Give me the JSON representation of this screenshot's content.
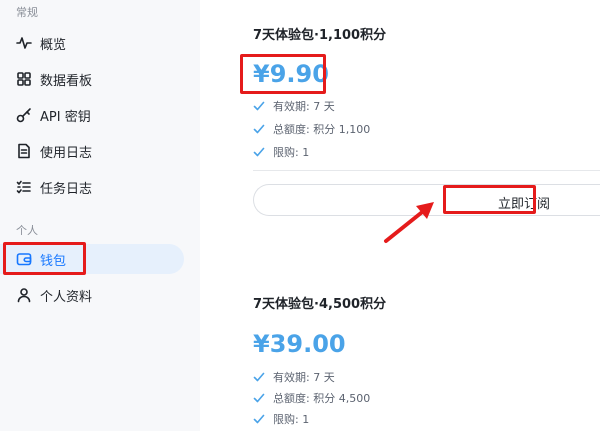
{
  "sidebar": {
    "section_general": "常规",
    "section_personal": "个人",
    "items": [
      {
        "label": "概览",
        "icon": "activity-icon"
      },
      {
        "label": "数据看板",
        "icon": "dashboard-grid-icon"
      },
      {
        "label": "API 密钥",
        "icon": "key-icon"
      },
      {
        "label": "使用日志",
        "icon": "document-icon"
      },
      {
        "label": "任务日志",
        "icon": "task-list-icon"
      },
      {
        "label": "钱包",
        "icon": "wallet-icon",
        "active": true
      },
      {
        "label": "个人资料",
        "icon": "user-icon"
      }
    ]
  },
  "plans": [
    {
      "title": "7天体验包·1,100积分",
      "price": "¥9.90",
      "features": [
        "有效期: 7 天",
        "总额度: 积分 1,100",
        "限购: 1"
      ],
      "button_label": "立即订阅"
    },
    {
      "title": "7天体验包·4,500积分",
      "price": "¥39.00",
      "features": [
        "有效期: 7 天",
        "总额度: 积分 4,500",
        "限购: 1"
      ]
    }
  ],
  "colors": {
    "accent": "#4aa3e8",
    "highlight": "#e51b1b",
    "active_bg": "#e6f0fc"
  }
}
